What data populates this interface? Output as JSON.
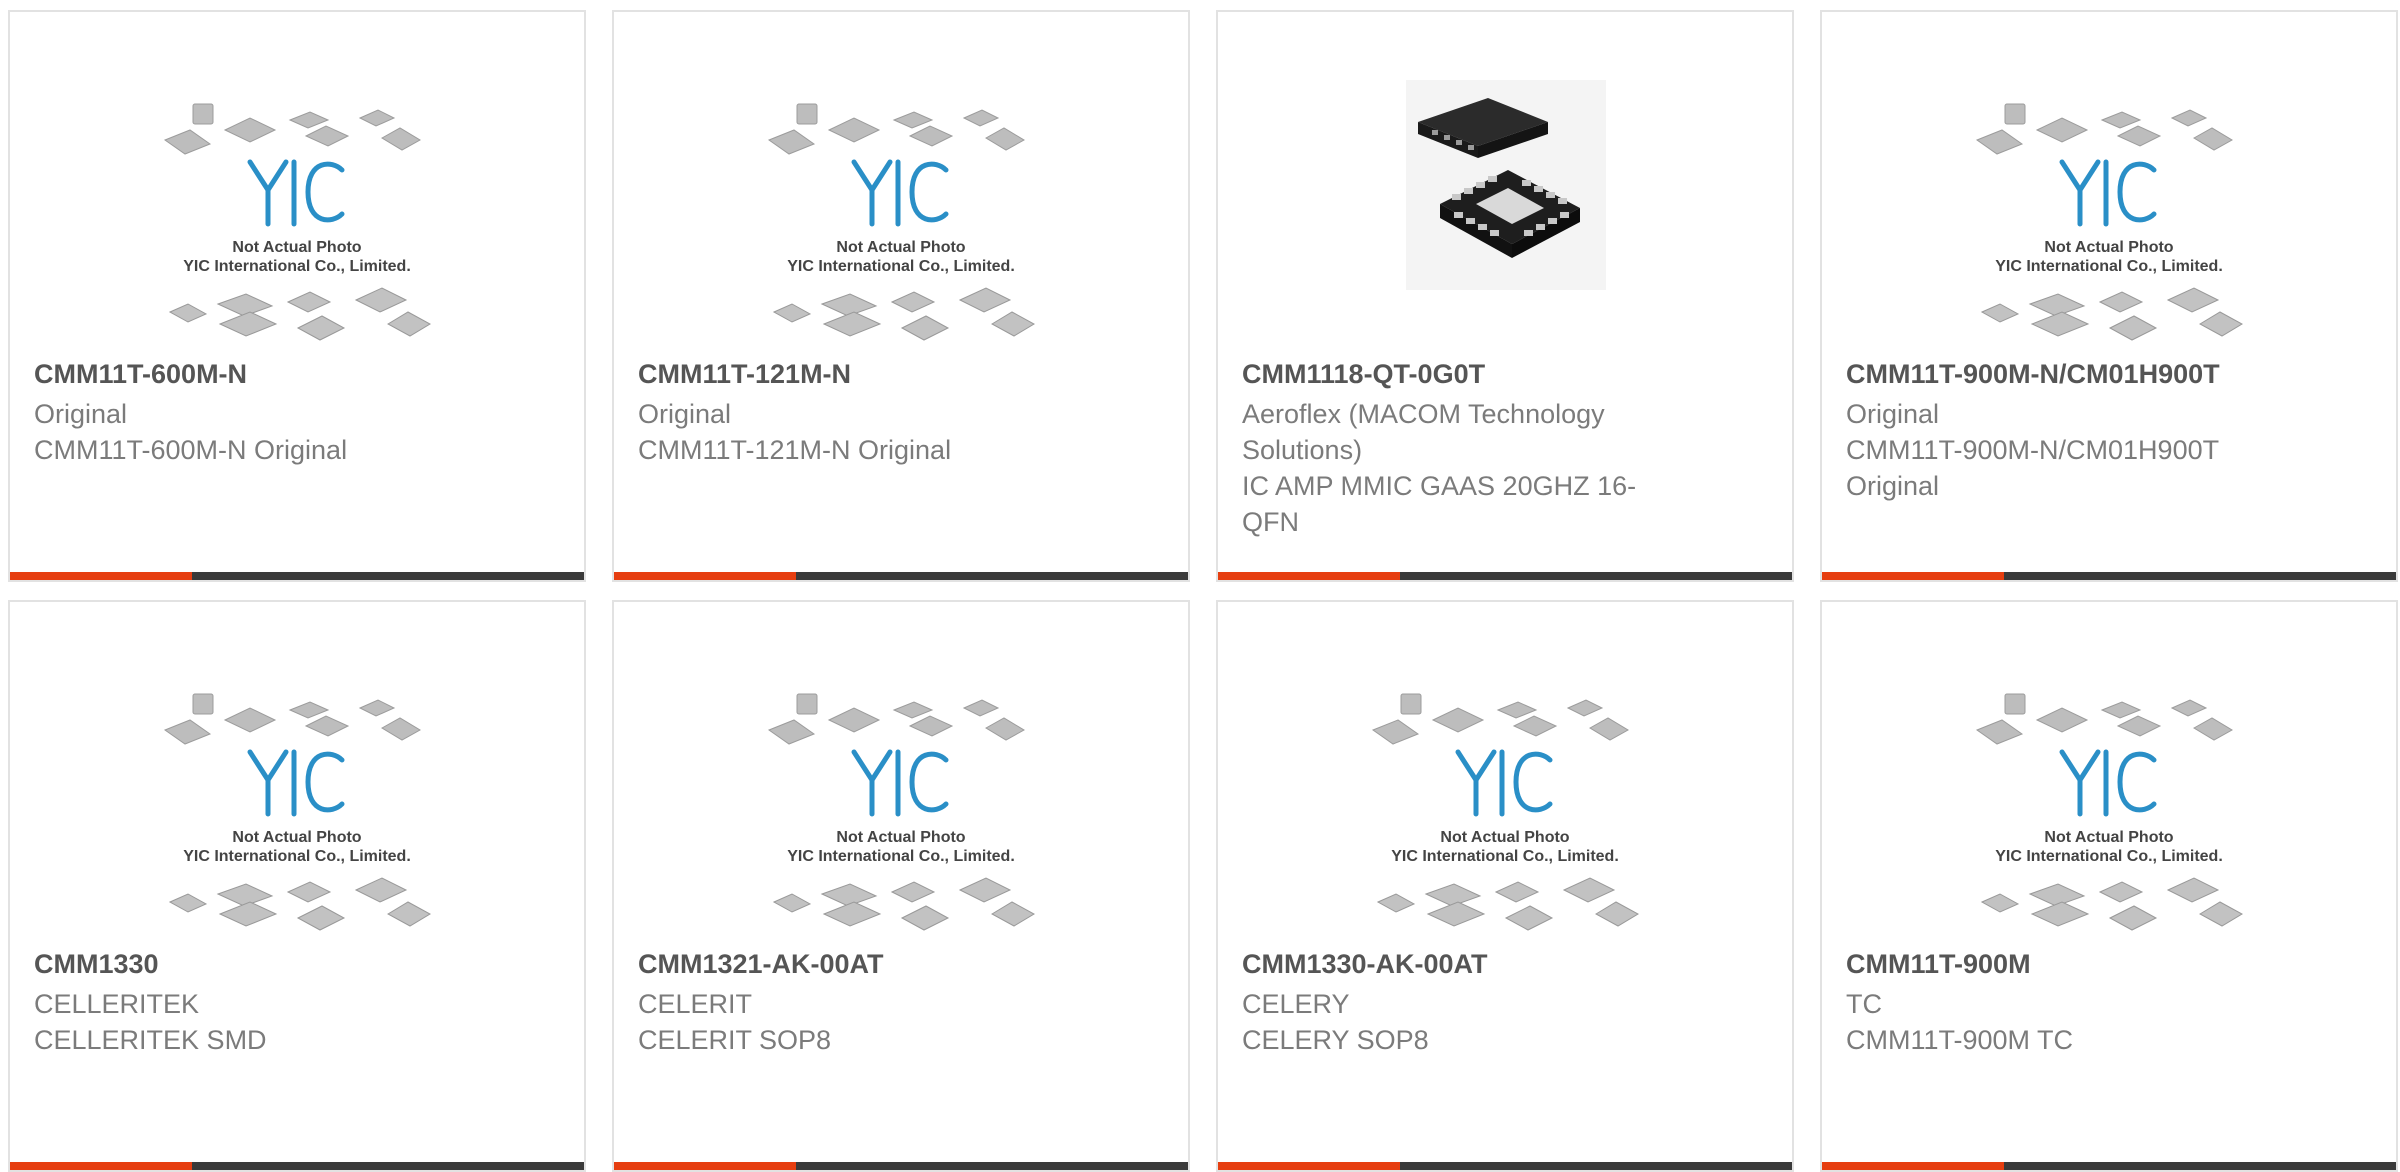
{
  "products": [
    {
      "part": "CMM11T-600M-N",
      "brand": "Original",
      "desc": "CMM11T-600M-N Original",
      "image": "placeholder",
      "placeholder_line1": "Not Actual Photo",
      "placeholder_line2": "YIC International Co., Limited."
    },
    {
      "part": "CMM11T-121M-N",
      "brand": "Original",
      "desc": "CMM11T-121M-N Original",
      "image": "placeholder",
      "placeholder_line1": "Not Actual Photo",
      "placeholder_line2": "YIC International Co., Limited."
    },
    {
      "part": "CMM1118-QT-0G0T",
      "brand": "Aeroflex (MACOM Technology Solutions)",
      "desc": "IC AMP MMIC GAAS 20GHZ 16-QFN",
      "image": "qfn-chip-photo"
    },
    {
      "part": "CMM11T-900M-N/CM01H900T",
      "brand": "Original",
      "desc": "CMM11T-900M-N/CM01H900T Original",
      "image": "placeholder",
      "placeholder_line1": "Not Actual Photo",
      "placeholder_line2": "YIC International Co., Limited."
    },
    {
      "part": "CMM1330",
      "brand": "CELLERITEK",
      "desc": "CELLERITEK SMD",
      "image": "placeholder",
      "placeholder_line1": "Not Actual Photo",
      "placeholder_line2": "YIC International Co., Limited."
    },
    {
      "part": "CMM1321-AK-00AT",
      "brand": "CELERIT",
      "desc": "CELERIT SOP8",
      "image": "placeholder",
      "placeholder_line1": "Not Actual Photo",
      "placeholder_line2": "YIC International Co., Limited."
    },
    {
      "part": "CMM1330-AK-00AT",
      "brand": "CELERY",
      "desc": "CELERY SOP8",
      "image": "placeholder",
      "placeholder_line1": "Not Actual Photo",
      "placeholder_line2": "YIC International Co., Limited."
    },
    {
      "part": "CMM11T-900M",
      "brand": "TC",
      "desc": "CMM11T-900M TC",
      "image": "placeholder",
      "placeholder_line1": "Not Actual Photo",
      "placeholder_line2": "YIC International Co., Limited."
    }
  ],
  "colors": {
    "accent": "#e63e10",
    "bar": "#3a3a3a",
    "title": "#555555",
    "text": "#7b7b7b",
    "logo_blue": "#2a8fc7"
  }
}
